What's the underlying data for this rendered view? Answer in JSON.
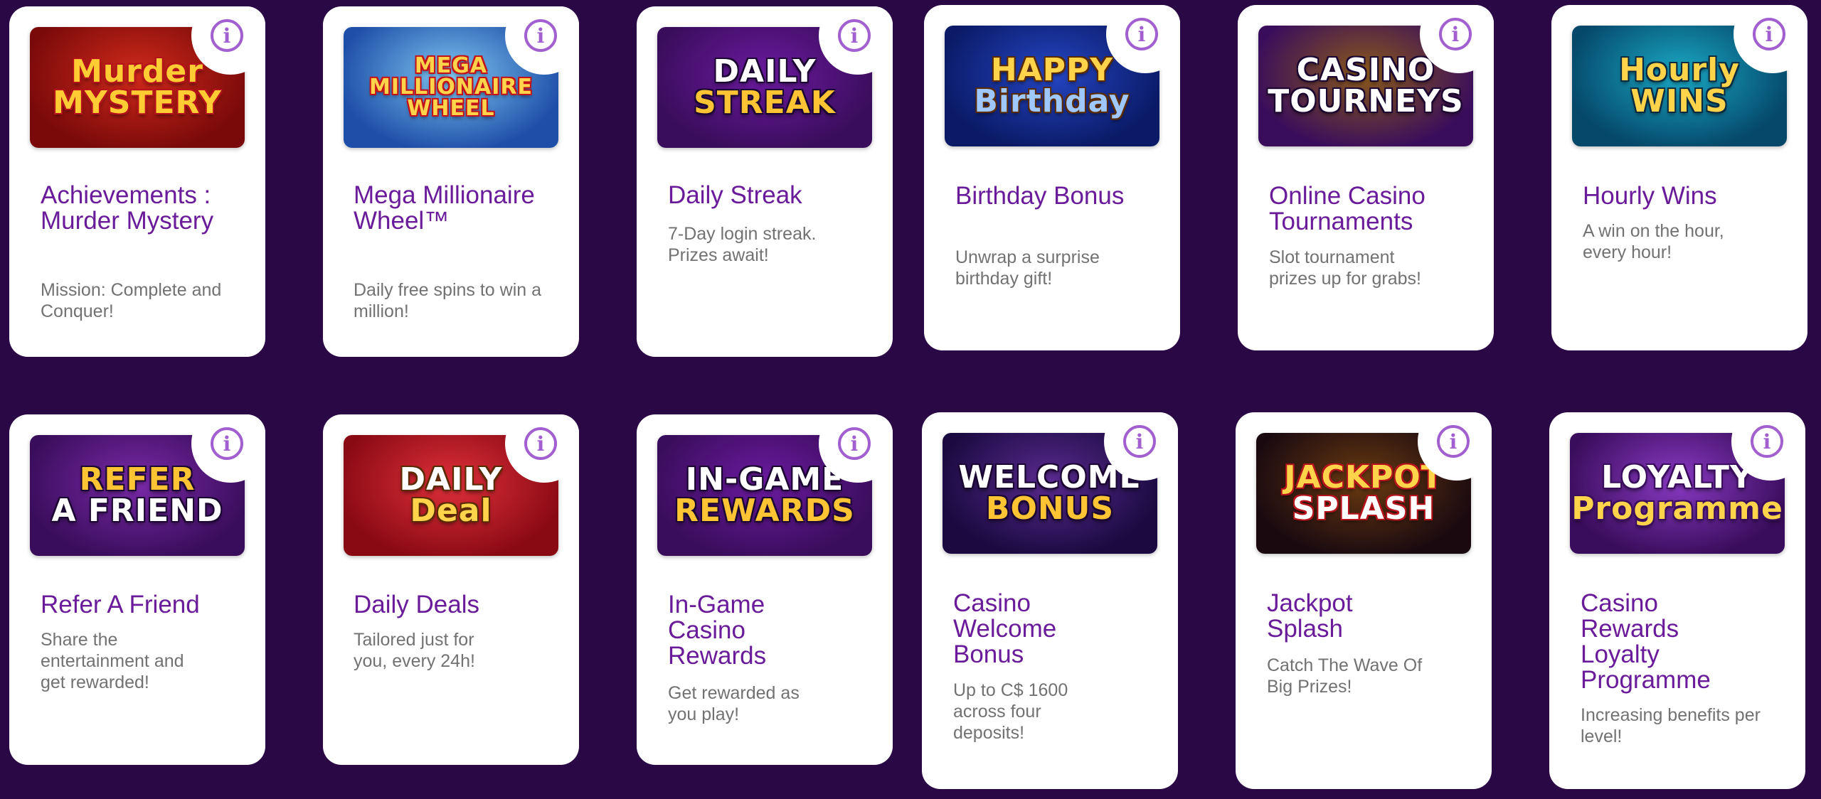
{
  "cards": [
    {
      "title": "Achievements : Murder Mystery",
      "desc": "Mission: Complete and Conquer!",
      "banner": {
        "lines": [
          "Murder",
          "MYSTERY"
        ],
        "bg": "#7a0a0a",
        "bg2": "#d12a1a",
        "fg": "#ffcc33",
        "stroke": "#b5121b"
      },
      "info_icon": "info-icon"
    },
    {
      "title": "Mega Millionaire Wheel™",
      "desc": "Daily free spins to win a million!",
      "banner": {
        "lines": [
          "MEGA",
          "MILLIONAIRE",
          "WHEEL"
        ],
        "bg": "#1d4fa8",
        "bg2": "#7fc4f0",
        "fg": "#ffd34a",
        "stroke": "#c4121b"
      },
      "info_icon": "info-icon"
    },
    {
      "title": "Daily Streak",
      "desc": "7-Day login streak. Prizes await!",
      "banner": {
        "lines": [
          "DAILY",
          "STREAK"
        ],
        "bg": "#3a0d5c",
        "bg2": "#6c1aa0",
        "fg": "#ffffff",
        "fg2": "#ffc433",
        "stroke": "#1a0630"
      },
      "info_icon": "info-icon"
    },
    {
      "title": "Birthday Bonus",
      "desc": "Unwrap a surprise birthday gift!",
      "banner": {
        "lines": [
          "HAPPY",
          "Birthday"
        ],
        "bg": "#0a1a66",
        "bg2": "#2546c4",
        "fg": "#ffd34a",
        "fg2": "#9ec8ff",
        "stroke": "#5a2a00"
      },
      "info_icon": "info-icon"
    },
    {
      "title": "Online Casino Tournaments",
      "desc": "Slot tournament prizes up for grabs!",
      "banner": {
        "lines": [
          "CASINO",
          "TOURNEYS"
        ],
        "bg": "#3a0d5c",
        "bg2": "#8a5a1a",
        "fg": "#ffffff",
        "stroke": "#1a0630"
      },
      "info_icon": "info-icon"
    },
    {
      "title": "Hourly Wins",
      "desc": "A win on the hour, every hour!",
      "banner": {
        "lines": [
          "Hourly",
          "WINS"
        ],
        "bg": "#05486a",
        "bg2": "#1aa8c4",
        "fg": "#ffd34a",
        "stroke": "#0a2a40"
      },
      "info_icon": "info-icon"
    },
    {
      "title": "Refer A Friend",
      "desc": "Share the entertainment and get rewarded!",
      "banner": {
        "lines": [
          "REFER",
          "A FRIEND"
        ],
        "bg": "#3a0d5c",
        "bg2": "#7a2aa8",
        "fg": "#ffc433",
        "fg2": "#ffffff",
        "stroke": "#1a0630"
      },
      "info_icon": "info-icon"
    },
    {
      "title": "Daily Deals",
      "desc": "Tailored just for you, every 24h!",
      "banner": {
        "lines": [
          "DAILY",
          "Deal"
        ],
        "bg": "#8a0a14",
        "bg2": "#e0303a",
        "fg": "#ffffff",
        "fg2": "#ffd34a",
        "stroke": "#5a2a00"
      },
      "info_icon": "info-icon"
    },
    {
      "title": "In-Game Casino Rewards",
      "desc": "Get rewarded as you play!",
      "banner": {
        "lines": [
          "IN-GAME",
          "REWARDS"
        ],
        "bg": "#3a0d5c",
        "bg2": "#6c1aa0",
        "fg": "#ffffff",
        "fg2": "#ffc433",
        "stroke": "#1a0630"
      },
      "info_icon": "info-icon"
    },
    {
      "title": "Casino Welcome Bonus",
      "desc": "Up to C$ 1600 across four deposits!",
      "banner": {
        "lines": [
          "WELCOME",
          "BONUS"
        ],
        "bg": "#1a0a40",
        "bg2": "#5a2a90",
        "fg": "#ffffff",
        "fg2": "#ffc433",
        "stroke": "#1a0630"
      },
      "info_icon": "info-icon"
    },
    {
      "title": "Jackpot Splash",
      "desc": "Catch The Wave Of Big Prizes!",
      "banner": {
        "lines": [
          "JACKPOT",
          "SPLASH"
        ],
        "bg": "#1a0a10",
        "bg2": "#6a3a10",
        "fg": "#ffd34a",
        "fg2": "#ffffff",
        "stroke": "#b5121b"
      },
      "info_icon": "info-icon"
    },
    {
      "title": "Casino Rewards Loyalty Programme",
      "desc": "Increasing benefits per level!",
      "banner": {
        "lines": [
          "LOYALTY",
          "Programme"
        ],
        "bg": "#3a0d5c",
        "bg2": "#8a3ac4",
        "fg": "#ffffff",
        "fg2": "#ffd34a",
        "stroke": "#3a0d5c"
      },
      "info_icon": "info-icon"
    }
  ]
}
